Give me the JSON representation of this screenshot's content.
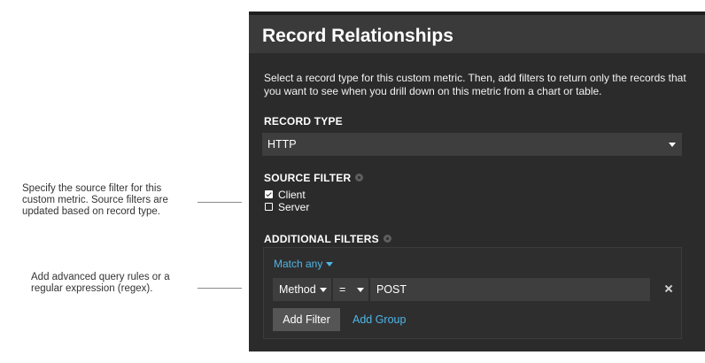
{
  "annotations": {
    "source_filter_note": "Specify the source filter for this custom metric. Source filters are updated based on record type.",
    "advanced_query_note": "Add advanced query rules or a regular expression (regex)."
  },
  "panel": {
    "title": "Record Relationships",
    "intro": "Select a record type for this custom metric. Then, add filters to return only the records that you want to see when you drill down on this metric from a chart or table.",
    "record_type": {
      "label": "RECORD TYPE",
      "selected": "HTTP"
    },
    "source_filter": {
      "label": "SOURCE FILTER",
      "options": [
        {
          "label": "Client",
          "checked": true
        },
        {
          "label": "Server",
          "checked": false
        }
      ]
    },
    "additional_filters": {
      "label": "ADDITIONAL FILTERS",
      "match_mode": "Match any",
      "rule": {
        "field": "Method",
        "operator": "=",
        "value": "POST"
      },
      "add_filter_label": "Add Filter",
      "add_group_label": "Add Group"
    }
  },
  "colors": {
    "panel_bg": "#2b2b2b",
    "header_bg": "#3a3a3a",
    "accent_link": "#4fb6e8",
    "button_bg": "#555555"
  },
  "icons": {
    "info": "info-icon",
    "remove": "close-icon",
    "dropdown": "chevron-down-icon",
    "checkbox": "checkbox-icon"
  }
}
